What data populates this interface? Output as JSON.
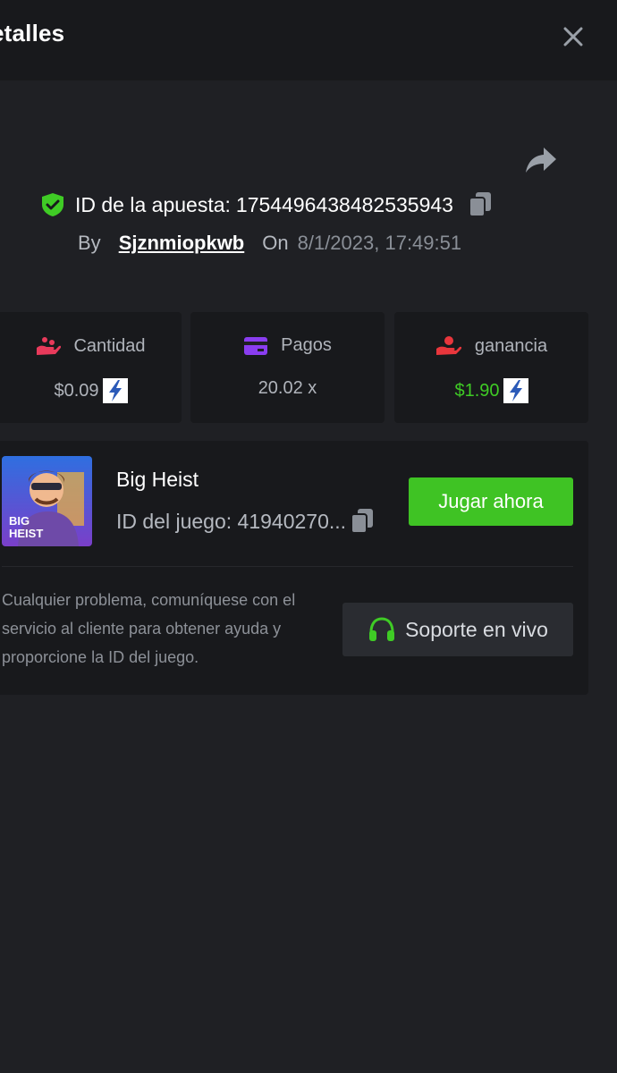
{
  "header": {
    "title": "etalles"
  },
  "bet": {
    "id_label": "ID de la apuesta:",
    "id_value": "1754496438482535943",
    "by_label": "By",
    "username": "Sjznmiopkwb",
    "on_label": "On",
    "date": "8/1/2023, 17:49:51"
  },
  "stats": [
    {
      "label": "Cantidad",
      "value": "$0.09",
      "icon": "hand-coins-icon"
    },
    {
      "label": "Pagos",
      "value": "20.02 x",
      "icon": "card-icon"
    },
    {
      "label": "ganancia",
      "value": "$1.90",
      "icon": "hand-money-icon"
    }
  ],
  "game": {
    "name": "Big Heist",
    "id_label": "ID del juego: 41940270...",
    "thumb_title_line1": "BIG",
    "thumb_title_line2": "HEIST",
    "play_label": "Jugar ahora"
  },
  "help": {
    "text": "Cualquier problema, comuníquese con el servicio al cliente para obtener ayuda y proporcione la ID del juego.",
    "support_label": "Soporte en vivo"
  },
  "colors": {
    "accent_green": "#3fc324",
    "background": "#1f2024",
    "card": "#18191c"
  }
}
